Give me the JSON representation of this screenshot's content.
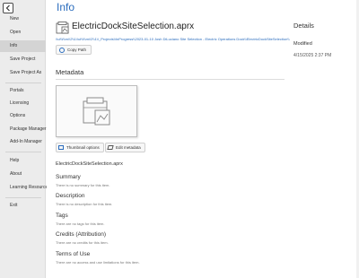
{
  "sidebar": {
    "items": [
      {
        "label": "New"
      },
      {
        "label": "Open"
      },
      {
        "label": "Info"
      },
      {
        "label": "Save Project"
      },
      {
        "label": "Save Project As"
      },
      {
        "label": "Portals"
      },
      {
        "label": "Licensing"
      },
      {
        "label": "Options"
      },
      {
        "label": "Package Manager"
      },
      {
        "label": "Add-In Manager"
      },
      {
        "label": "Help"
      },
      {
        "label": "About"
      },
      {
        "label": "Learning Resources"
      },
      {
        "label": "Exit"
      }
    ],
    "active_index": 2
  },
  "main": {
    "title": "Info",
    "file_name": "ElectricDockSiteSelection.aprx",
    "file_path": "\\\\ul\\\\l\\\\m\\\\2\\\\1\\\\ul\\\\l\\\\m\\\\2\\\\1\\\\_Projects\\\\InProgress\\\\2023-01-10 Josh DiLuciano Site Selection - Electric Operations Dock\\\\ElectricDockSiteSelection\\\\",
    "copy_path_label": "Copy Path",
    "metadata_title": "Metadata",
    "thumbnail_options_label": "Thumbnail options",
    "edit_metadata_label": "Edit metadata",
    "metadata_filename": "ElectricDockSiteSelection.aprx",
    "sections": [
      {
        "heading": "Summary",
        "text": "There is no summary for this item."
      },
      {
        "heading": "Description",
        "text": "There is no description for this item."
      },
      {
        "heading": "Tags",
        "text": "There are no tags for this item."
      },
      {
        "heading": "Credits (Attribution)",
        "text": "There are no credits for this item."
      },
      {
        "heading": "Terms of Use",
        "text": "There are no access and use limitations for this item."
      }
    ]
  },
  "details": {
    "title": "Details",
    "modified_label": "Modified",
    "modified_value": "4/15/2025 2:37 PM"
  },
  "colors": {
    "accent": "#2a6cbd",
    "sidebar_bg": "#ececec",
    "active_item_bg": "#d4d4d4"
  }
}
